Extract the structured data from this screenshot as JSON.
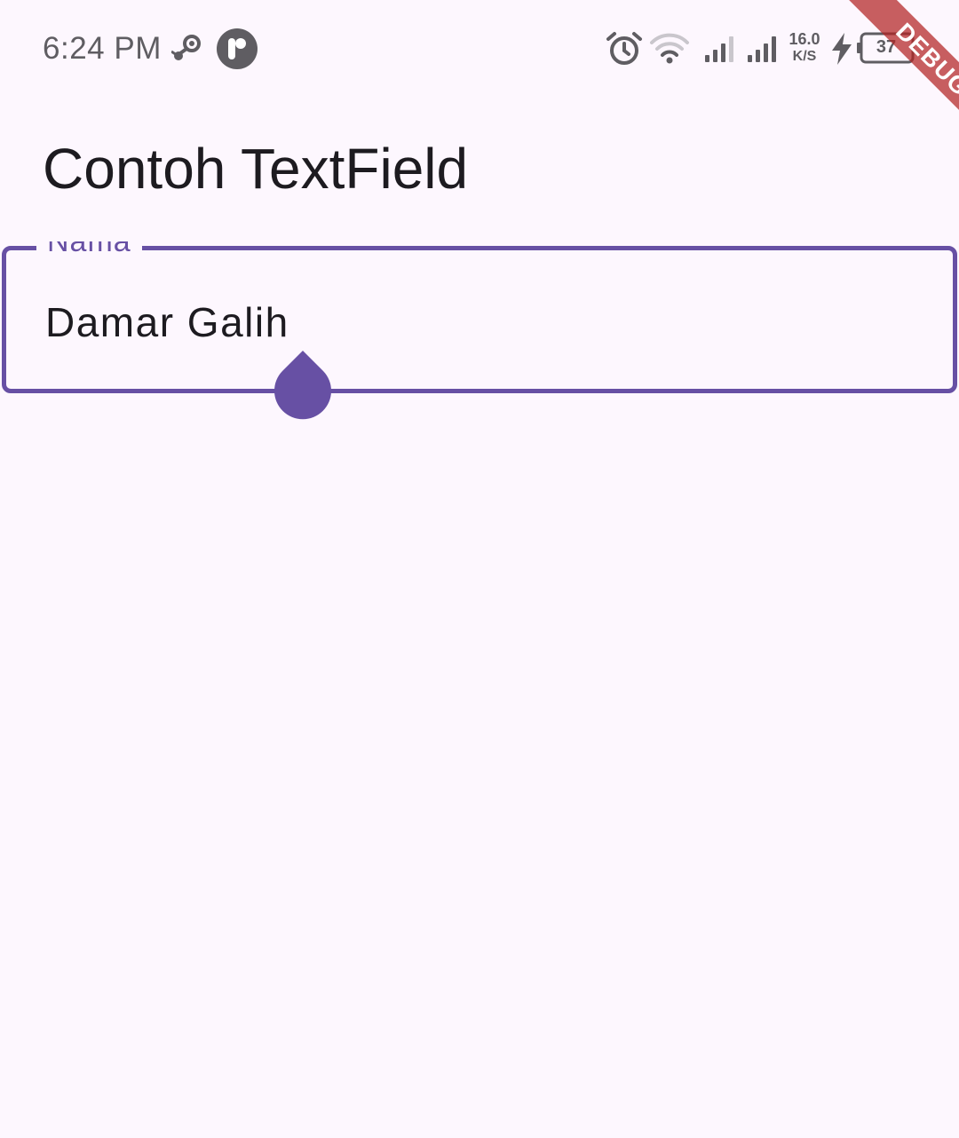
{
  "status_bar": {
    "time": "6:24 PM",
    "icons": [
      "steam-icon",
      "app-badge-icon",
      "alarm-icon",
      "wifi-icon",
      "signal-icon",
      "signal-icon",
      "charging-icon",
      "battery-icon"
    ],
    "net_speed_value": "16.0",
    "net_speed_unit": "K/S",
    "battery_level": "37"
  },
  "debug_banner": {
    "label": "DEBUG",
    "color": "#b22222"
  },
  "app_bar": {
    "title": "Contoh TextField"
  },
  "form": {
    "name_field": {
      "label": "Nama",
      "value": "Damar Galih",
      "state": "focused"
    }
  },
  "colors": {
    "background": "#fdf7fe",
    "primary": "#6750a4",
    "on_surface": "#1d1b20",
    "status_icon": "#5f5d62"
  }
}
